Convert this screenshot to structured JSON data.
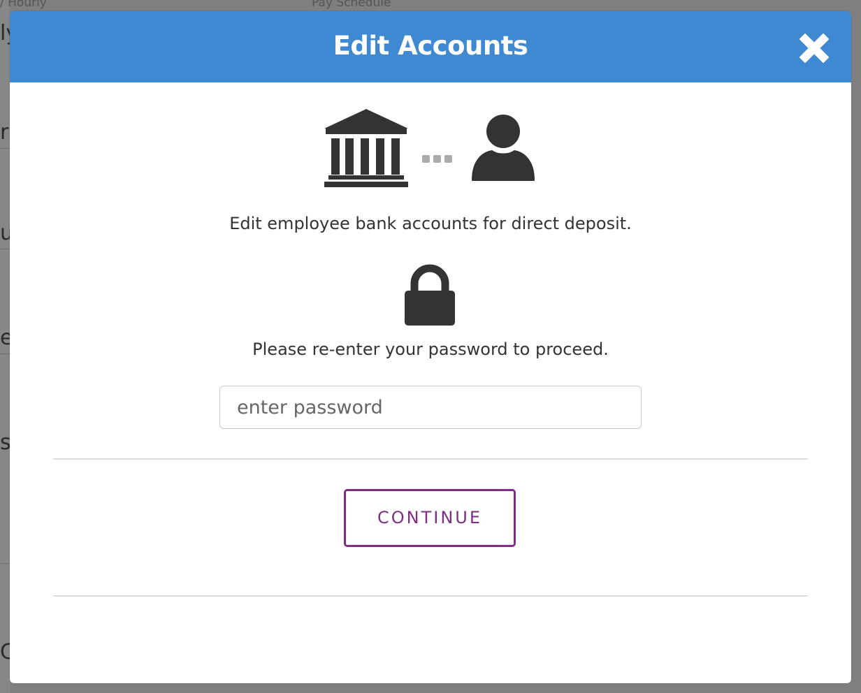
{
  "background": {
    "fragments": {
      "hourly_label": "/ Hourly",
      "pay_schedule_label": "Pay Schedule",
      "frag1": "ly",
      "frag2": "r",
      "frag3": "ul",
      "frag4": "eg",
      "frag5": "s",
      "frag6": "C"
    }
  },
  "modal": {
    "title": "Edit Accounts",
    "close_icon": "close-icon",
    "header_color": "#3f88d2",
    "icons": {
      "bank": "bank-icon",
      "connector": "dots-icon",
      "user": "user-icon",
      "lock": "lock-icon"
    },
    "description": "Edit employee bank accounts for direct deposit.",
    "prompt": "Please re-enter your password to proceed.",
    "password": {
      "placeholder": "enter password",
      "value": ""
    },
    "continue_label": "CONTINUE",
    "accent_color": "#7f2e86"
  }
}
